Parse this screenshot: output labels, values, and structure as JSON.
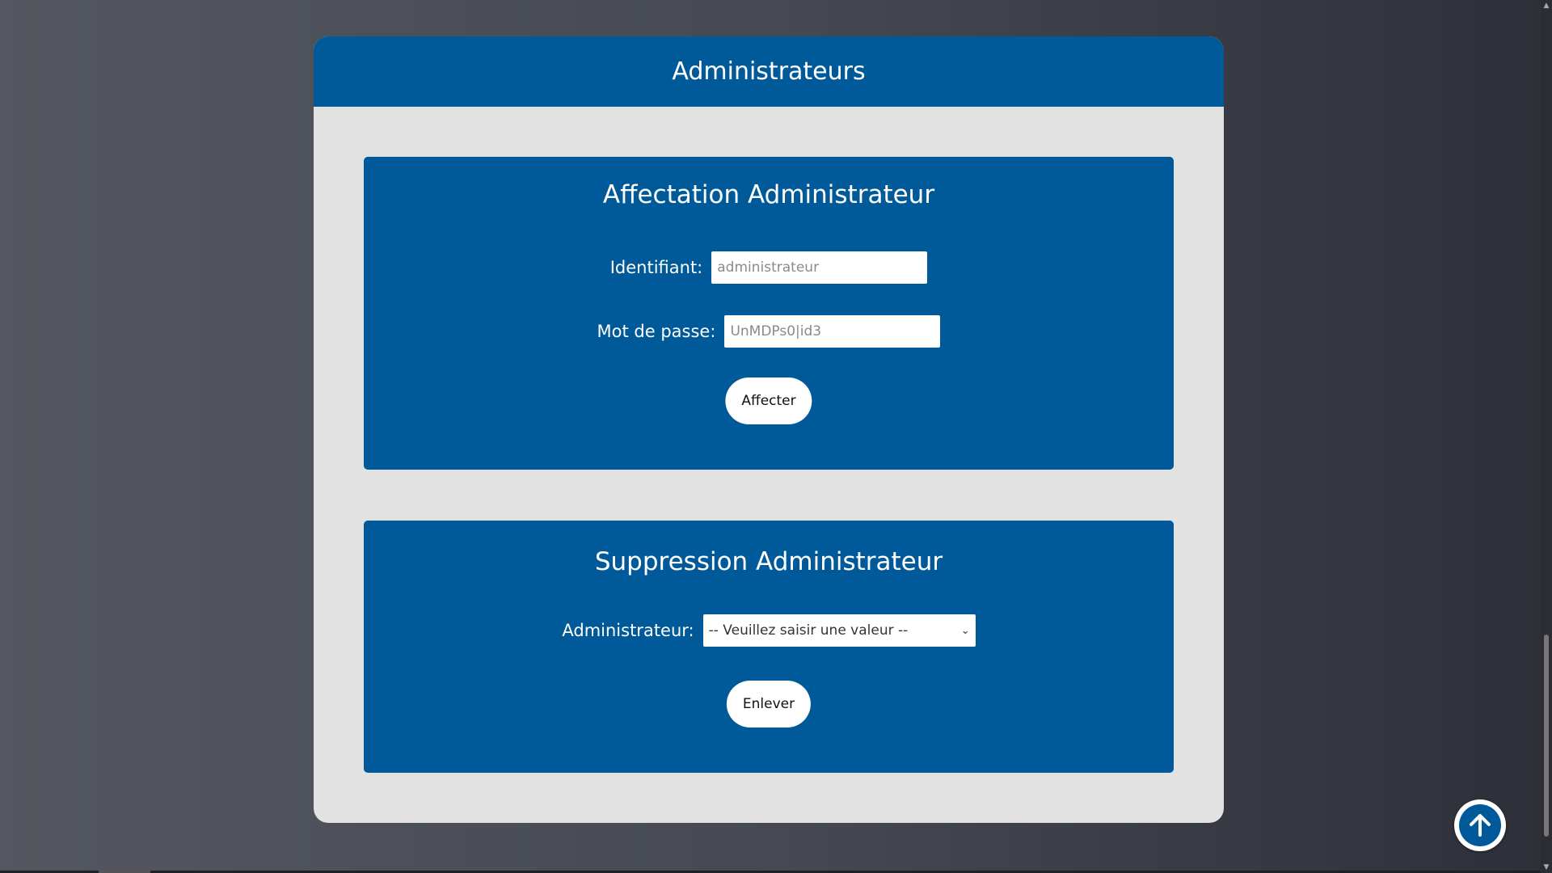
{
  "header": {
    "title": "Administrateurs"
  },
  "assign_panel": {
    "title": "Affectation Administrateur",
    "id_label": "Identifiant:",
    "id_placeholder": "administrateur",
    "password_label": "Mot de passe:",
    "password_placeholder": "UnMDPs0|id3",
    "submit_label": "Affecter"
  },
  "remove_panel": {
    "title": "Suppression Administrateur",
    "admin_label": "Administrateur:",
    "admin_select_value": "-- Veuillez saisir une valeur --",
    "submit_label": "Enlever"
  },
  "scroll_top": {
    "icon": "arrow-up-icon"
  },
  "colors": {
    "primary": "#005a9a",
    "card_background": "#e2e2e2",
    "button_background": "#ffffff"
  }
}
